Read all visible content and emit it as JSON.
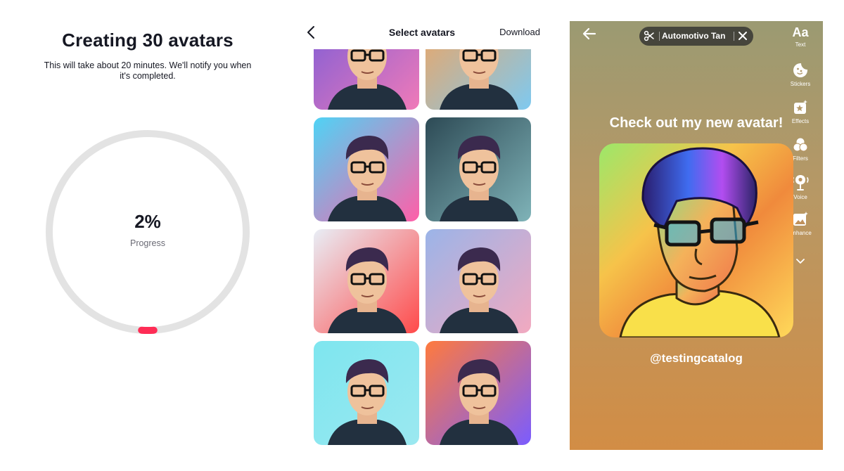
{
  "progress_screen": {
    "title": "Creating 30 avatars",
    "subtitle": "This will take about 20 minutes. We'll notify you when it's completed.",
    "percent_text": "2%",
    "progress_value": 0.02,
    "progress_label": "Progress",
    "accent_color": "#fe2c55",
    "track_color": "#e3e3e3"
  },
  "select_screen": {
    "title": "Select avatars",
    "download_label": "Download",
    "back_icon": "chevron-left-icon",
    "avatars": [
      {
        "style": "neon portrait",
        "bg": [
          "#7a5cd8",
          "#f07ab8"
        ]
      },
      {
        "style": "astronaut",
        "bg": [
          "#f5a35b",
          "#7ec9f0"
        ]
      },
      {
        "style": "rainbow",
        "bg": [
          "#4fd3f5",
          "#ff5fa8"
        ]
      },
      {
        "style": "cinematic",
        "bg": [
          "#2d4a55",
          "#7fb3b8"
        ]
      },
      {
        "style": "paint splash",
        "bg": [
          "#e8eef6",
          "#ff4a4a"
        ]
      },
      {
        "style": "space suit",
        "bg": [
          "#9bb4e8",
          "#f2a9c0"
        ]
      },
      {
        "style": "cartoon",
        "bg": [
          "#7ee6ef",
          "#9be8f0"
        ]
      },
      {
        "style": "abstract",
        "bg": [
          "#ff7a3d",
          "#7a5cff"
        ]
      }
    ]
  },
  "story_screen": {
    "sound_name": "Automotivo Tan",
    "caption": "Check out my new avatar!",
    "handle": "@testingcatalog",
    "tools": [
      {
        "label": "Text",
        "icon": "text-aa-icon",
        "glyph": "Aa"
      },
      {
        "label": "Stickers",
        "icon": "sticker-icon"
      },
      {
        "label": "Effects",
        "icon": "effects-icon"
      },
      {
        "label": "Filters",
        "icon": "filters-icon"
      },
      {
        "label": "Voice",
        "icon": "voice-icon"
      },
      {
        "label": "Enhance",
        "icon": "enhance-icon"
      }
    ]
  }
}
